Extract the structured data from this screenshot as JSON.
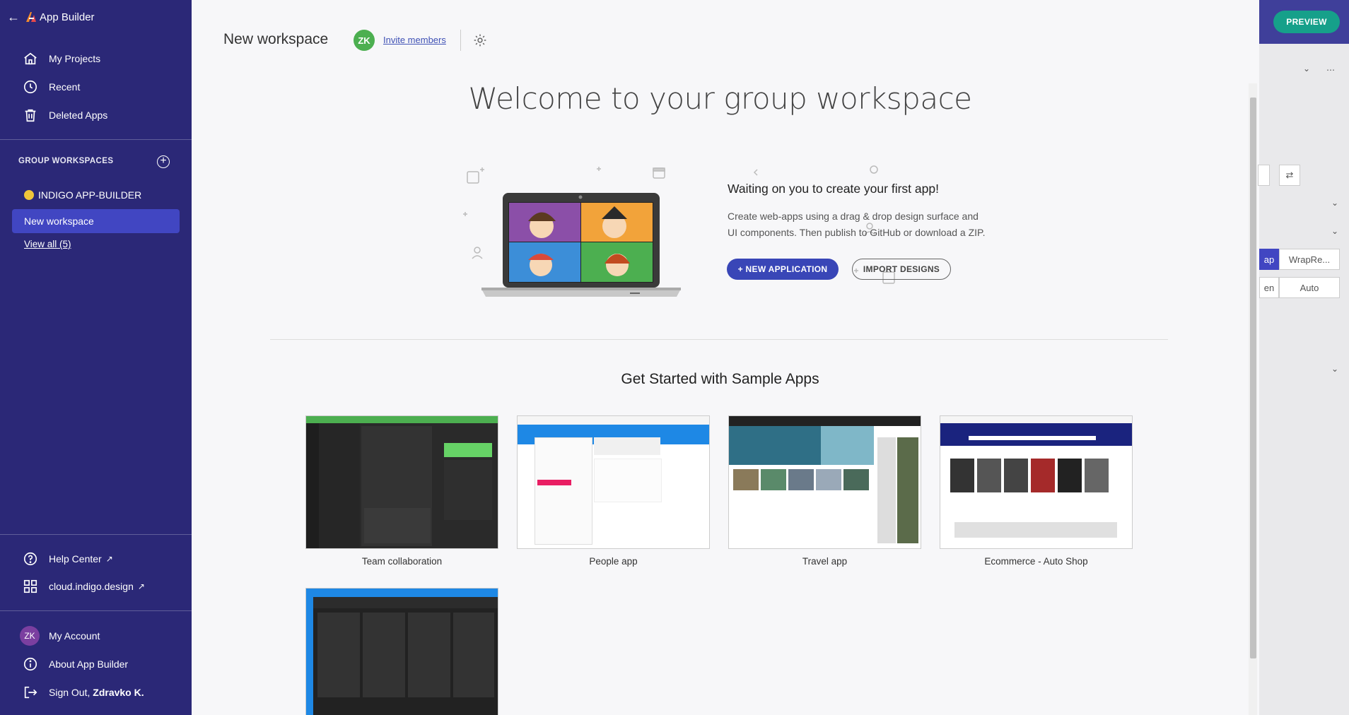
{
  "app": {
    "name": "App Builder"
  },
  "sidebar": {
    "nav": [
      {
        "label": "My Projects",
        "icon": "home-icon"
      },
      {
        "label": "Recent",
        "icon": "clock-icon"
      },
      {
        "label": "Deleted Apps",
        "icon": "trash-icon"
      }
    ],
    "group_workspaces_title": "GROUP WORKSPACES",
    "org_name": "INDIGO APP-BUILDER",
    "active_workspace": "New workspace",
    "view_all": "View all (5)",
    "help_center": "Help Center",
    "cloud_link": "cloud.indigo.design",
    "account": {
      "initials": "ZK",
      "label": "My Account"
    },
    "about": "About App Builder",
    "sign_out_prefix": "Sign Out, ",
    "sign_out_user": "Zdravko K."
  },
  "header": {
    "workspace_title": "New workspace",
    "member_initials": "ZK",
    "invite_label": "Invite members"
  },
  "welcome": {
    "heading": "Welcome to your group workspace",
    "cta_title": "Waiting on you to create your first app!",
    "cta_desc_line1": "Create web-apps using a drag & drop design surface and",
    "cta_desc_line2": "UI components. Then publish to GitHub or download a ZIP.",
    "new_app_label": "+ NEW APPLICATION",
    "import_label": "IMPORT DESIGNS"
  },
  "samples": {
    "title": "Get Started with Sample Apps",
    "items": [
      {
        "label": "Team collaboration"
      },
      {
        "label": "People app"
      },
      {
        "label": "Travel app"
      },
      {
        "label": "Ecommerce - Auto Shop"
      },
      {
        "label": ""
      }
    ]
  },
  "right_panel": {
    "preview_label": "PREVIEW",
    "wrap_label": "WrapRe...",
    "ap_label": "ap",
    "en_label": "en",
    "auto_label": "Auto"
  },
  "colors": {
    "sidebar_bg": "#2b2877",
    "active_ws": "#4146c2",
    "primary": "#3946b7",
    "preview": "#16a08a",
    "avatar": "#7b3fa0"
  }
}
